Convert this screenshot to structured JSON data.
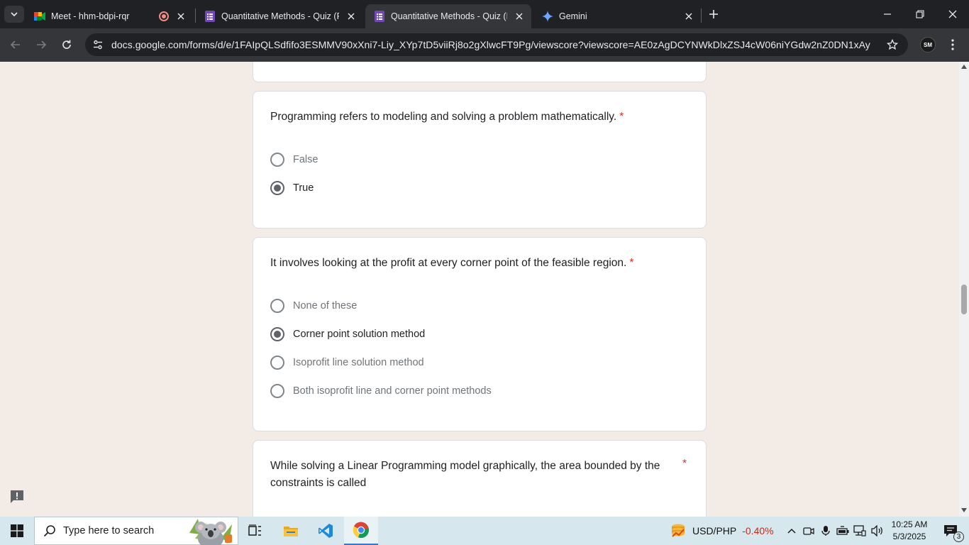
{
  "browser": {
    "tabs": [
      {
        "title": "Meet - hhm-bdpi-rqr",
        "icon": "google-meet-icon",
        "active": false
      },
      {
        "title": "Quantitative Methods - Quiz (F",
        "icon": "google-forms-icon",
        "active": false
      },
      {
        "title": "Quantitative Methods - Quiz (F",
        "icon": "google-forms-icon",
        "active": true
      },
      {
        "title": "Gemini",
        "icon": "gemini-icon",
        "active": false
      }
    ],
    "url": "docs.google.com/forms/d/e/1FAIpQLSdfifo3ESMMV90xXni7-Liy_XYp7tD5viiRj8o2gXlwcFT9Pg/viewscore?viewscore=AE0zAgDCYNWkDlxZSJ4cW06niYGdw2nZ0DN1xAyP3sRX...",
    "profile_initials": "SM"
  },
  "questions": [
    {
      "text": "Programming refers to modeling and solving a problem mathematically.",
      "required_mark": "*",
      "options": [
        {
          "label": "False",
          "selected": false
        },
        {
          "label": "True",
          "selected": true
        }
      ]
    },
    {
      "text": "It involves looking at the profit at every corner point of the feasible region.",
      "required_mark": "*",
      "options": [
        {
          "label": "None of these",
          "selected": false
        },
        {
          "label": "Corner point solution method",
          "selected": true
        },
        {
          "label": "Isoprofit line solution method",
          "selected": false
        },
        {
          "label": "Both isoprofit line and corner point methods",
          "selected": false
        }
      ]
    },
    {
      "text_line1": "While solving a Linear Programming model graphically, the area bounded by the",
      "text_line2": "constraints is called",
      "required_mark": "*"
    }
  ],
  "taskbar": {
    "search_placeholder": "Type here to search",
    "ticker_pair": "USD/PHP",
    "ticker_change": "-0.40%",
    "time": "10:25 AM",
    "date": "5/3/2025",
    "notification_count": "3"
  },
  "colors": {
    "page_background": "#f3ebe6",
    "required_asterisk": "#d93025",
    "ticker_negative": "#c42b1c"
  }
}
